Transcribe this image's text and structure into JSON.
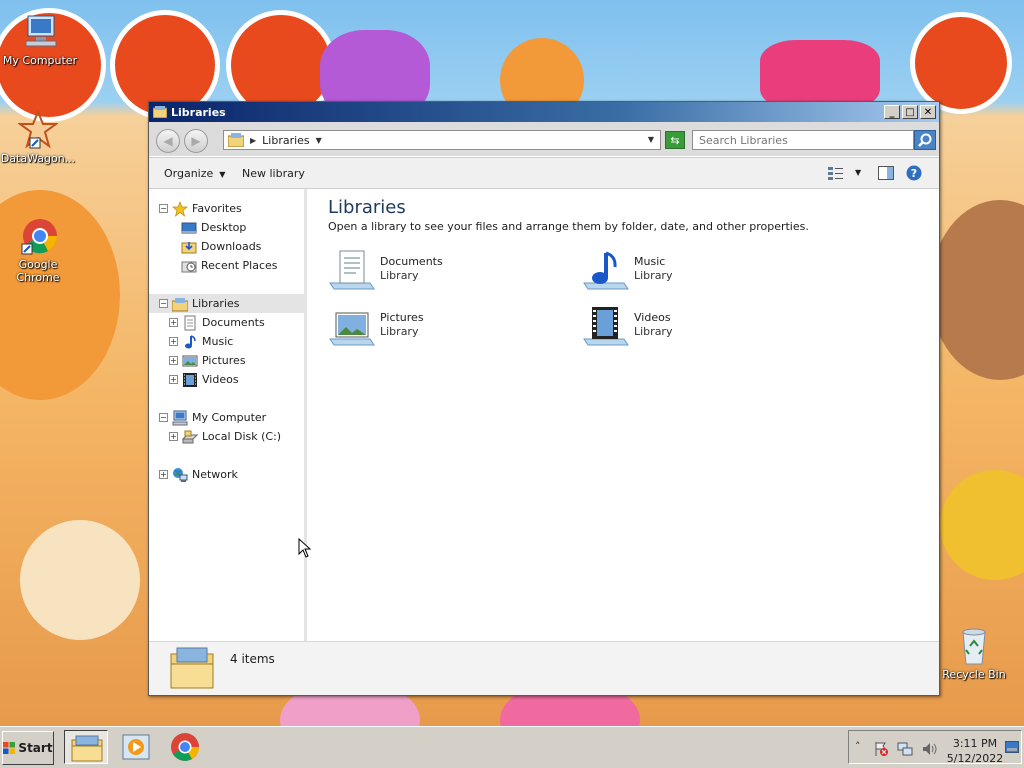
{
  "desktop": {
    "icons": [
      {
        "label": "My Computer"
      },
      {
        "label": "DataWagon..."
      },
      {
        "label": "Google Chrome"
      },
      {
        "label": "Recycle Bin"
      }
    ]
  },
  "window": {
    "title": "Libraries",
    "address": {
      "crumb": "Libraries"
    },
    "search": {
      "placeholder": "Search Libraries"
    },
    "toolbar": {
      "organize": "Organize",
      "new_library": "New library"
    },
    "nav": {
      "favorites": "Favorites",
      "desktop": "Desktop",
      "downloads": "Downloads",
      "recent_places": "Recent Places",
      "libraries": "Libraries",
      "documents": "Documents",
      "music": "Music",
      "pictures": "Pictures",
      "videos": "Videos",
      "my_computer": "My Computer",
      "local_disk": "Local Disk (C:)",
      "network": "Network"
    },
    "content": {
      "title": "Libraries",
      "description": "Open a library to see your files and arrange them by folder, date, and other properties.",
      "libraries": [
        {
          "name": "Documents",
          "type": "Library"
        },
        {
          "name": "Music",
          "type": "Library"
        },
        {
          "name": "Pictures",
          "type": "Library"
        },
        {
          "name": "Videos",
          "type": "Library"
        }
      ]
    },
    "status": {
      "count": "4 items"
    }
  },
  "taskbar": {
    "start_label": "Start",
    "clock": {
      "time": "3:11 PM",
      "date": "5/12/2022"
    }
  }
}
